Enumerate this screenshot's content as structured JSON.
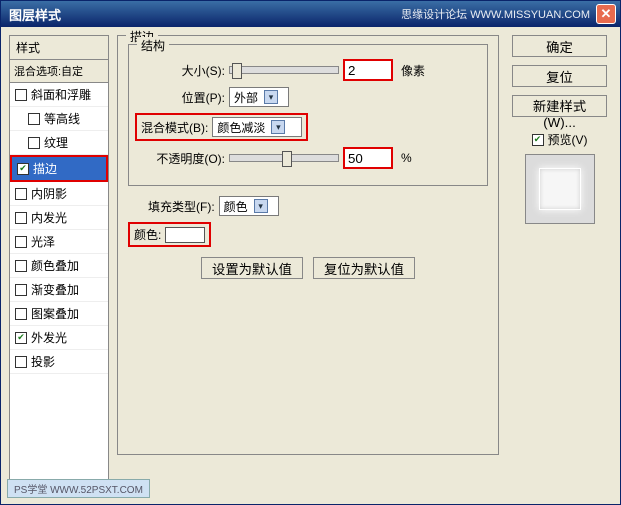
{
  "title": "图层样式",
  "brand": "思缘设计论坛  WWW.MISSYUAN.COM",
  "watermark": "PS学堂  WWW.52PSXT.COM",
  "styles": {
    "header": "样式",
    "blend_label": "混合选项:自定",
    "items": [
      {
        "label": "斜面和浮雕",
        "checked": false,
        "indent": false
      },
      {
        "label": "等高线",
        "checked": false,
        "indent": true
      },
      {
        "label": "纹理",
        "checked": false,
        "indent": true
      },
      {
        "label": "描边",
        "checked": true,
        "indent": false,
        "selected": true,
        "highlight": true
      },
      {
        "label": "内阴影",
        "checked": false,
        "indent": false
      },
      {
        "label": "内发光",
        "checked": false,
        "indent": false
      },
      {
        "label": "光泽",
        "checked": false,
        "indent": false
      },
      {
        "label": "颜色叠加",
        "checked": false,
        "indent": false
      },
      {
        "label": "渐变叠加",
        "checked": false,
        "indent": false
      },
      {
        "label": "图案叠加",
        "checked": false,
        "indent": false
      },
      {
        "label": "外发光",
        "checked": true,
        "indent": false
      },
      {
        "label": "投影",
        "checked": false,
        "indent": false
      }
    ]
  },
  "panel": {
    "title": "描边",
    "structure_title": "结构",
    "size_label": "大小(S):",
    "size_value": "2",
    "size_unit": "像素",
    "position_label": "位置(P):",
    "position_value": "外部",
    "blend_label": "混合模式(B):",
    "blend_value": "颜色减淡",
    "opacity_label": "不透明度(O):",
    "opacity_value": "50",
    "opacity_unit": "%",
    "filltype_label": "填充类型(F):",
    "filltype_value": "颜色",
    "color_label": "颜色:",
    "color_value": "#FFFFFF",
    "btn_default": "设置为默认值",
    "btn_reset": "复位为默认值"
  },
  "buttons": {
    "ok": "确定",
    "cancel": "复位",
    "new_style": "新建样式(W)...",
    "preview": "预览(V)"
  }
}
